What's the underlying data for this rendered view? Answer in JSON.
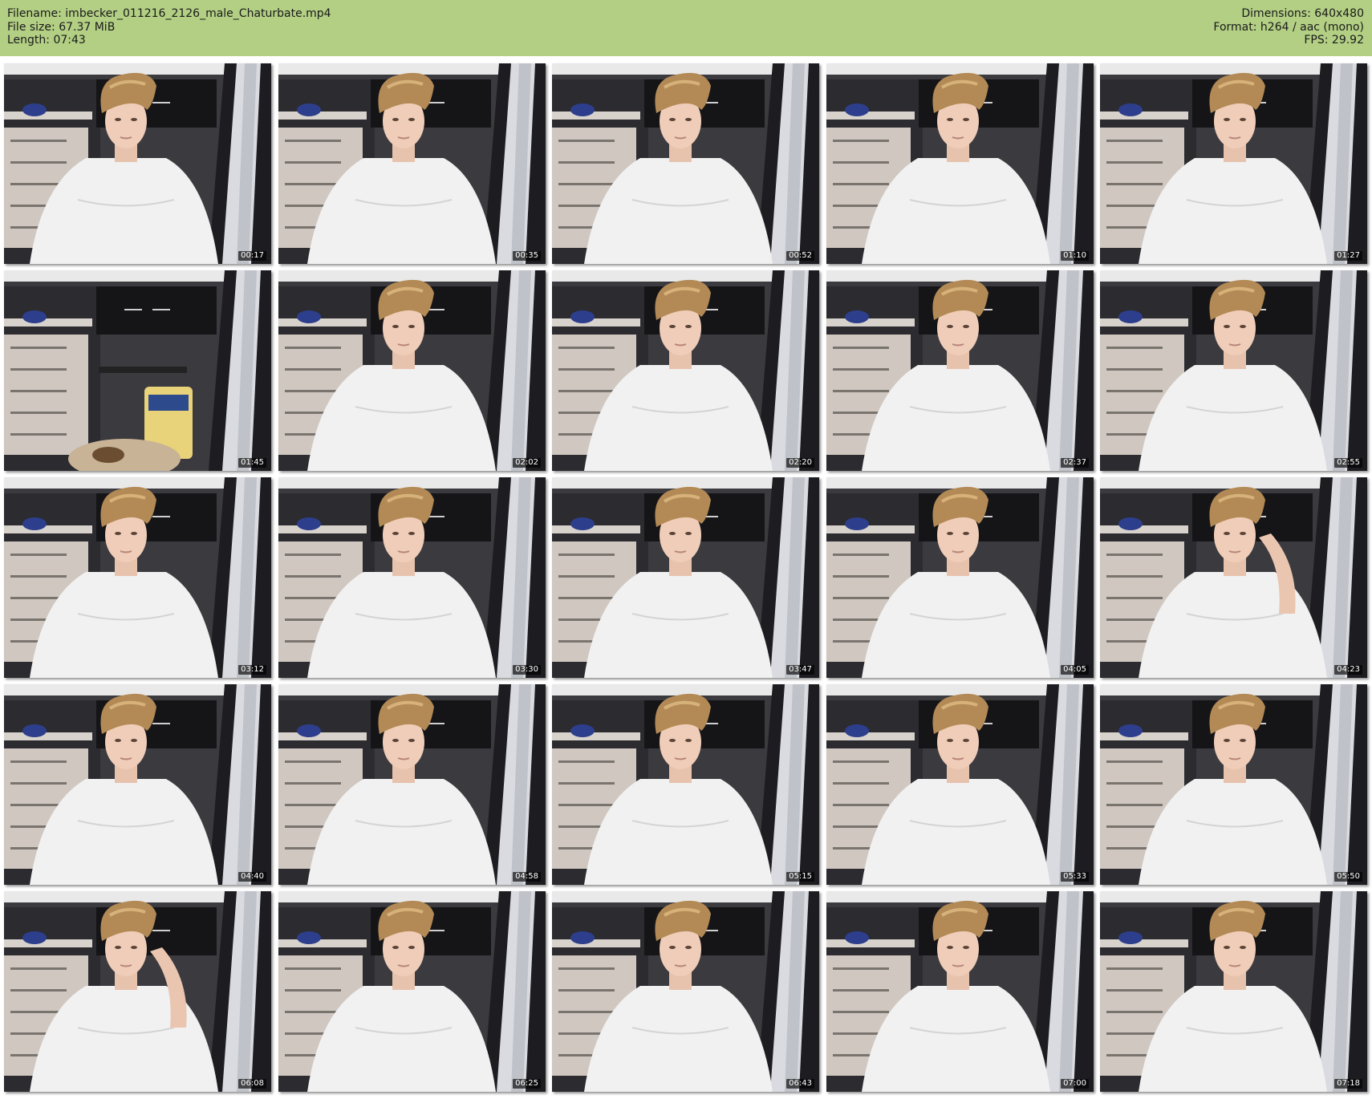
{
  "header": {
    "filename_line": "Filename: imbecker_011216_2126_male_Chaturbate.mp4",
    "filesize_line": "File size: 67.37 MiB",
    "length_line": "Length: 07:43",
    "dimensions_line": "Dimensions: 640x480",
    "format_line": "Format: h264 / aac (mono)",
    "fps_line": "FPS: 29.92"
  },
  "colors": {
    "header_bg": "#b3cf84",
    "page_bg": "#ffffff"
  },
  "thumbnails": [
    {
      "timestamp": "00:17",
      "variant": "person"
    },
    {
      "timestamp": "00:35",
      "variant": "person"
    },
    {
      "timestamp": "00:52",
      "variant": "person"
    },
    {
      "timestamp": "01:10",
      "variant": "person"
    },
    {
      "timestamp": "01:27",
      "variant": "person"
    },
    {
      "timestamp": "01:45",
      "variant": "empty-room"
    },
    {
      "timestamp": "02:02",
      "variant": "person"
    },
    {
      "timestamp": "02:20",
      "variant": "person"
    },
    {
      "timestamp": "02:37",
      "variant": "person"
    },
    {
      "timestamp": "02:55",
      "variant": "person"
    },
    {
      "timestamp": "03:12",
      "variant": "person"
    },
    {
      "timestamp": "03:30",
      "variant": "person"
    },
    {
      "timestamp": "03:47",
      "variant": "person"
    },
    {
      "timestamp": "04:05",
      "variant": "person"
    },
    {
      "timestamp": "04:23",
      "variant": "person-hand"
    },
    {
      "timestamp": "04:40",
      "variant": "person"
    },
    {
      "timestamp": "04:58",
      "variant": "person"
    },
    {
      "timestamp": "05:15",
      "variant": "person"
    },
    {
      "timestamp": "05:33",
      "variant": "person"
    },
    {
      "timestamp": "05:50",
      "variant": "person"
    },
    {
      "timestamp": "06:08",
      "variant": "person-hand"
    },
    {
      "timestamp": "06:25",
      "variant": "person"
    },
    {
      "timestamp": "06:43",
      "variant": "person"
    },
    {
      "timestamp": "07:00",
      "variant": "person"
    },
    {
      "timestamp": "07:18",
      "variant": "person"
    }
  ]
}
